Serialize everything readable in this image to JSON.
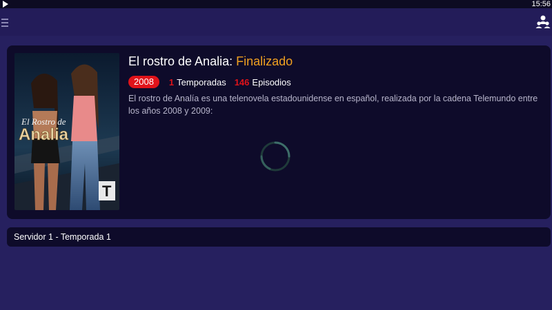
{
  "status_bar": {
    "time": "15:56"
  },
  "app_bar": {
    "menu_icon": "menu-icon",
    "account_icon": "account-group-icon"
  },
  "show": {
    "title": "El rostro de Analia:",
    "status": "Finalizado",
    "year": "2008",
    "seasons_count": "1",
    "seasons_label": "Temporadas",
    "episodes_count": "146",
    "episodes_label": "Episodios",
    "description": "El rostro de Analía es una telenovela estadounidense en español, realizada por la cadena Telemundo entre los años 2008 y 2009:",
    "poster": {
      "title_line1": "El Rostro de",
      "title_line2": "Analia",
      "network_logo": "T"
    }
  },
  "server": {
    "label": "Servidor 1 - Temporada 1"
  },
  "colors": {
    "background": "#26205f",
    "card": "#0e0b2a",
    "accent_red": "#e0131a",
    "status_orange": "#f0a020"
  }
}
